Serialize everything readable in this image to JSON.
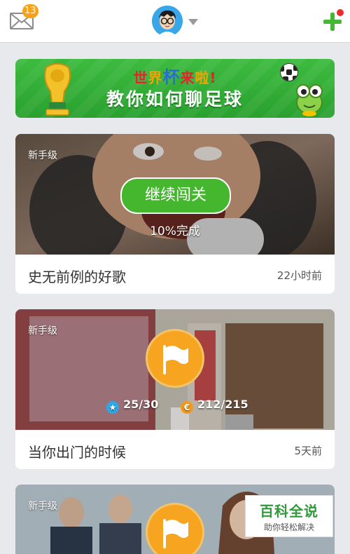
{
  "header": {
    "unread_count": "13",
    "icons": {
      "mail": "mail-icon",
      "avatar": "avatar",
      "dropdown": "caret-down-icon",
      "add": "plus-icon"
    },
    "accent": "#46b635"
  },
  "banner": {
    "headline_chars": [
      "世",
      "界",
      "杯",
      "来",
      "啦",
      "!"
    ],
    "headline_colors": [
      "#e8212b",
      "#f5a300",
      "#2c6bd8",
      "#e8212b",
      "#f5a300",
      "#e8212b"
    ],
    "subtitle": "教你如何聊足球"
  },
  "cards": [
    {
      "level": "新手级",
      "title": "史无前例的好歌",
      "time": "22小时前",
      "action_label": "继续闯关",
      "progress_text": "10%完成"
    },
    {
      "level": "新手级",
      "title": "当你出门的时候",
      "time": "5天前",
      "stars": "25/30",
      "coins": "212/215"
    },
    {
      "level": "新手级"
    }
  ],
  "watermark": {
    "brand": "百科全说",
    "tagline": "助你轻松解决"
  }
}
